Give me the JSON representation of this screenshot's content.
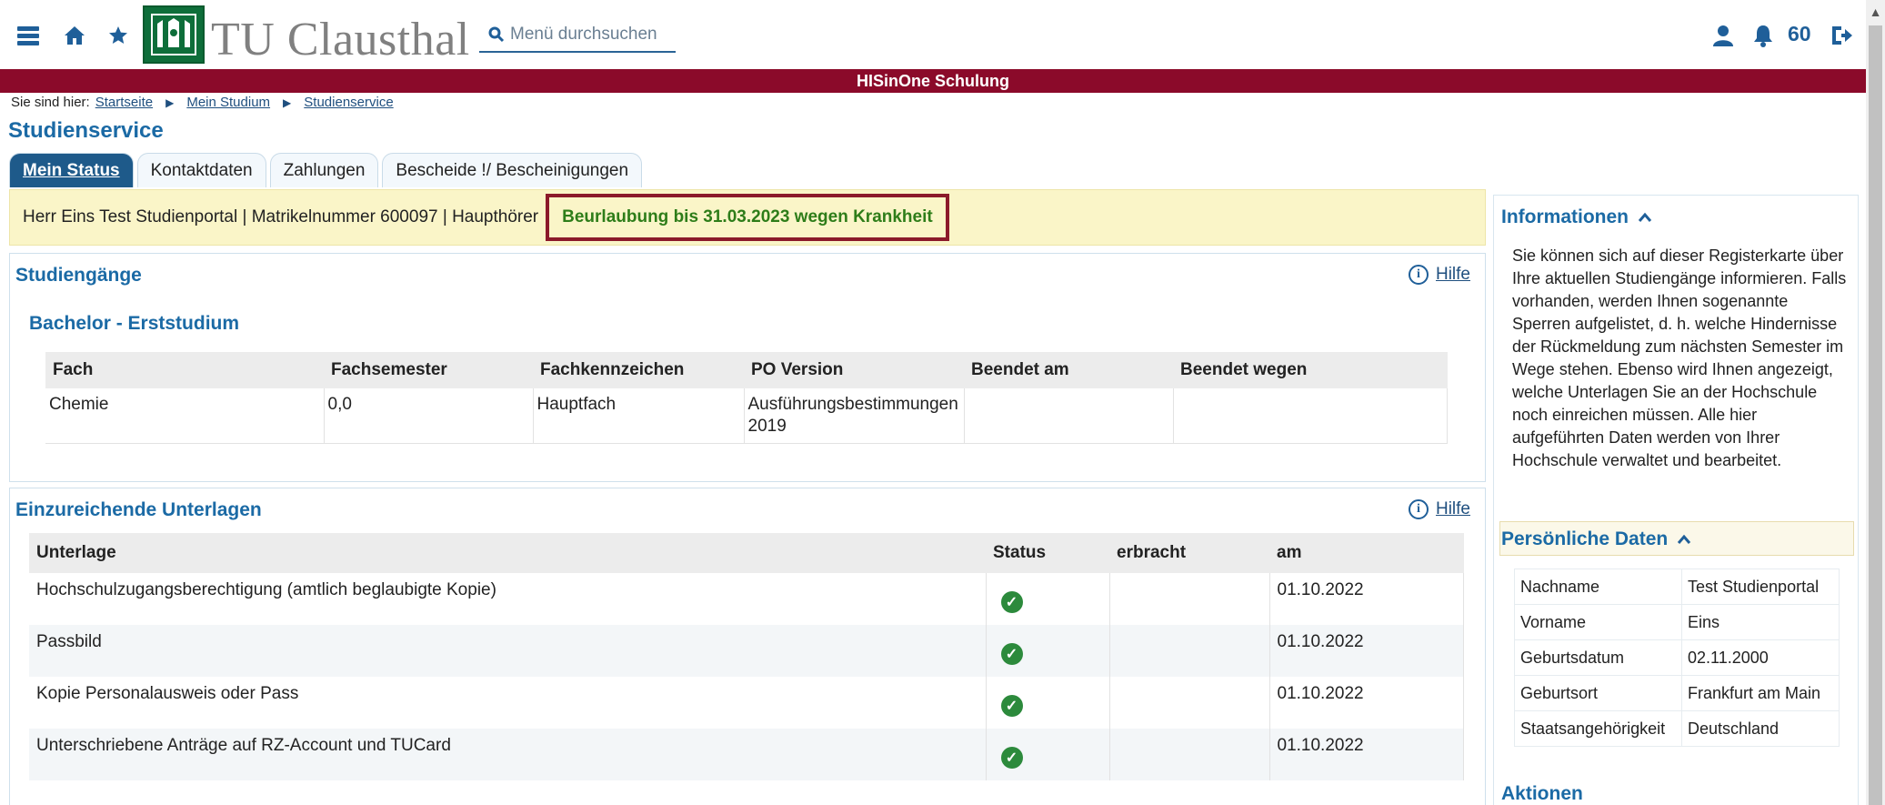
{
  "header": {
    "logo_text": "TU Clausthal",
    "search_placeholder": "Menü durchsuchen",
    "notification_count": "60",
    "banner": "HISinOne Schulung"
  },
  "breadcrumb": {
    "prefix": "Sie sind hier:",
    "items": [
      "Startseite",
      "Mein Studium",
      "Studienservice"
    ]
  },
  "page": {
    "title": "Studienservice",
    "tabs": [
      "Mein Status",
      "Kontaktdaten",
      "Zahlungen",
      "Bescheide !/ Bescheinigungen"
    ]
  },
  "status": {
    "info": "Herr Eins Test Studienportal | Matrikelnummer 600097 | Haupthörer",
    "highlight": "Beurlaubung bis 31.03.2023 wegen Krankheit"
  },
  "studiengaenge": {
    "title": "Studiengänge",
    "help": "Hilfe",
    "subtitle": "Bachelor - Erststudium",
    "columns": [
      "Fach",
      "Fachsemester",
      "Fachkennzeichen",
      "PO Version",
      "Beendet am",
      "Beendet wegen"
    ],
    "rows": [
      [
        "Chemie",
        "0,0",
        "Hauptfach",
        "Ausführungsbestimmungen 2019",
        "",
        ""
      ]
    ]
  },
  "unterlagen": {
    "title": "Einzureichende Unterlagen",
    "help": "Hilfe",
    "columns": [
      "Unterlage",
      "Status",
      "erbracht",
      "am"
    ],
    "rows": [
      [
        "Hochschulzugangsberechtigung (amtlich beglaubigte Kopie)",
        "check-icon",
        "",
        "01.10.2022"
      ],
      [
        "Passbild",
        "check-icon",
        "",
        "01.10.2022"
      ],
      [
        "Kopie Personalausweis oder Pass",
        "check-icon",
        "",
        "01.10.2022"
      ],
      [
        "Unterschriebene Anträge auf RZ-Account und TUCard",
        "check-icon",
        "",
        "01.10.2022"
      ]
    ]
  },
  "sidebar": {
    "info_title": "Informationen",
    "info_text": "Sie können sich auf dieser Registerkarte über Ihre aktuellen Studiengänge informieren. Falls vorhanden, werden Ihnen sogenannte Sperren aufgelistet, d. h. welche Hindernisse der Rückmeldung zum nächsten Semester im Wege stehen. Ebenso wird Ihnen angezeigt, welche Unterlagen Sie an der Hochschule noch einreichen müssen. Alle hier aufgeführten Daten werden von Ihrer Hochschule verwaltet und bearbeitet.",
    "personal_title": "Persönliche Daten",
    "personal": [
      [
        "Nachname",
        "Test Studienportal"
      ],
      [
        "Vorname",
        "Eins"
      ],
      [
        "Geburtsdatum",
        "02.11.2000"
      ],
      [
        "Geburtsort",
        "Frankfurt am Main"
      ],
      [
        "Staatsangehörigkeit",
        "Deutschland"
      ]
    ],
    "actions_title": "Aktionen"
  },
  "colors": {
    "brand_blue": "#1b6aa5",
    "banner_red": "#8b0a2a",
    "status_green": "#2e7d19",
    "logo_green": "#0e6e3a"
  }
}
